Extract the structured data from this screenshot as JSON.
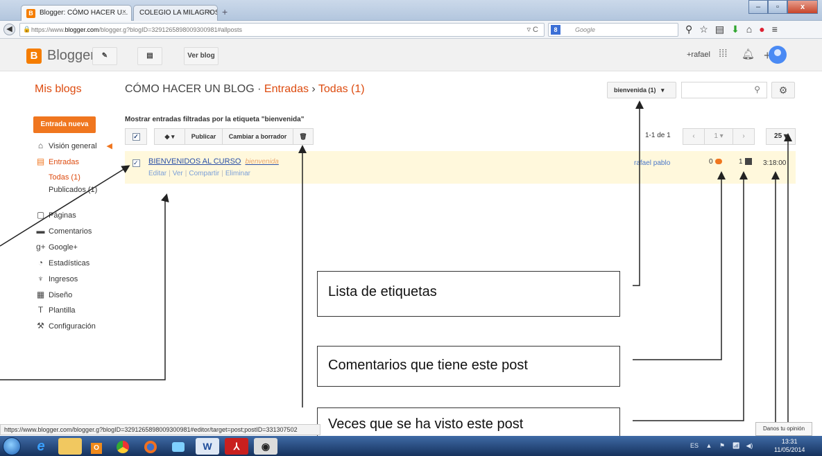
{
  "browser": {
    "tabs": [
      {
        "label": "Blogger: CÓMO HACER U...",
        "close": "×"
      },
      {
        "label": "COLEGIO LA MILAGROSA - SAL...",
        "close": "×"
      }
    ],
    "new_tab": "+",
    "url_prefix": "https://www.",
    "url_domain": "blogger.com",
    "url_rest": "/blogger.g?blogID=3291265898009300981#allposts",
    "search_placeholder": "Google",
    "window_buttons": {
      "minimize": "–",
      "maximize": "▫",
      "close": "x"
    }
  },
  "header": {
    "brand": "Blogger",
    "view_blog": "Ver blog",
    "user": "+rafael"
  },
  "titlebar": {
    "my_blogs": "Mis blogs",
    "blog_name": "CÓMO HACER UN BLOG",
    "sep1": "·",
    "entries": "Entradas",
    "sep2": "›",
    "all": "Todas (1)",
    "label_select": "bienvenida (1)"
  },
  "sidebar": {
    "new_post": "Entrada nueva",
    "items": [
      {
        "label": "Visión general",
        "icon": "home-icon"
      },
      {
        "label": "Entradas",
        "icon": "posts-icon"
      },
      {
        "label": "Todas (1)"
      },
      {
        "label": "Publicados (1)"
      },
      {
        "label": "Páginas",
        "icon": "pages-icon"
      },
      {
        "label": "Comentarios",
        "icon": "comments-icon"
      },
      {
        "label": "Google+",
        "icon": "googleplus-icon"
      },
      {
        "label": "Estadísticas",
        "icon": "stats-icon"
      },
      {
        "label": "Ingresos",
        "icon": "trophy-icon"
      },
      {
        "label": "Diseño",
        "icon": "layout-icon"
      },
      {
        "label": "Plantilla",
        "icon": "template-icon"
      },
      {
        "label": "Configuración",
        "icon": "wrench-icon"
      }
    ]
  },
  "main": {
    "filter_title": "Mostrar entradas filtradas por la etiqueta \"bienvenida\"",
    "toolbar": {
      "publish": "Publicar",
      "to_draft": "Cambiar a borrador"
    },
    "paging": "1-1 de 1",
    "page_select": "1",
    "per_page": "25",
    "post": {
      "title": "BIENVENIDOS AL CURSO",
      "tag": "bienvenida",
      "actions": [
        "Editar",
        "Ver",
        "Compartir",
        "Eliminar"
      ],
      "author": "rafael pablo",
      "comments": "0",
      "views": "1",
      "time": "3:18:00"
    }
  },
  "callouts": {
    "labels": "Lista de etiquetas",
    "comments": "Comentarios que tiene este post",
    "views": "Veces que se ha visto este post"
  },
  "status": {
    "url": "https://www.blogger.com/blogger.g?blogID=3291265898009300981#editor/target=post;postID=331307502",
    "feedback": "Danos tu opinión"
  },
  "taskbar": {
    "lang": "ES",
    "time": "13:31",
    "date": "11/05/2014"
  }
}
